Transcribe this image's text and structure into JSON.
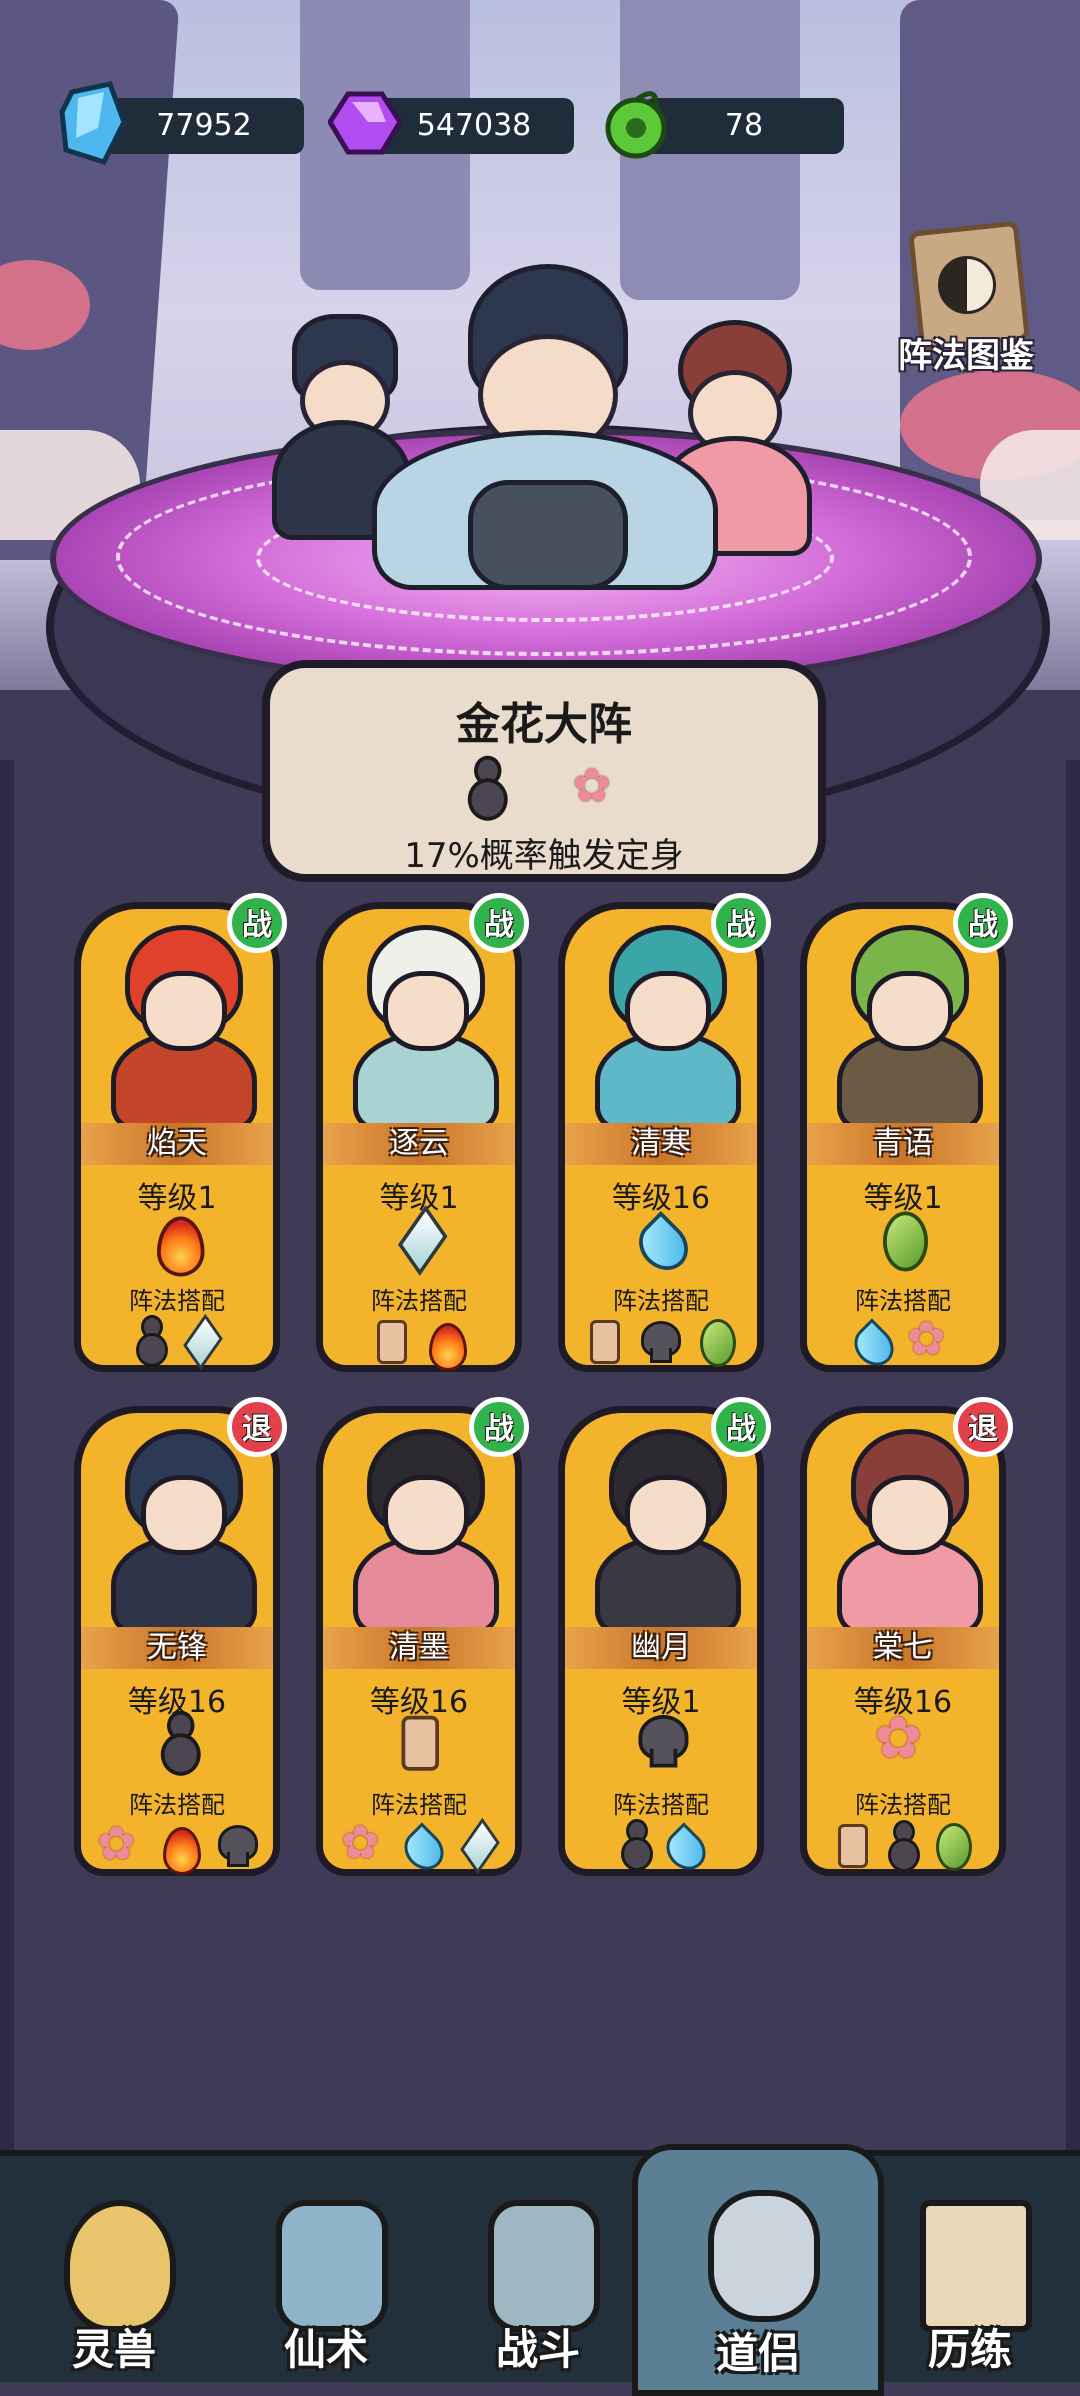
{
  "resources": [
    {
      "icon": "blue-crystal-icon",
      "value": "77952"
    },
    {
      "icon": "purple-gem-icon",
      "value": "547038"
    },
    {
      "icon": "green-jade-icon",
      "value": "78"
    }
  ],
  "codex": {
    "label": "阵法图鉴",
    "icon": "taiji-book-icon"
  },
  "formation": {
    "name": "金花大阵",
    "elements": [
      "gourd-icon",
      "flower-icon"
    ],
    "description": "17%概率触发定身"
  },
  "colors": {
    "fight_badge": "#2fb34a",
    "retire_badge": "#e2404a",
    "card_bg": "#f3b42c",
    "nav_bg": "#22303c",
    "nav_active": "#5b7f95"
  },
  "combo_label": "阵法搭配",
  "cards": [
    {
      "name": "焰天",
      "level": "等级1",
      "badge": "战",
      "status": "fight",
      "element": "fire",
      "combo": [
        "gourd",
        "metal"
      ],
      "hair": "#e0412a",
      "robe": "#c3452a"
    },
    {
      "name": "逐云",
      "level": "等级1",
      "badge": "战",
      "status": "fight",
      "element": "metal",
      "combo": [
        "talisman",
        "fire"
      ],
      "hair": "#eef0ea",
      "robe": "#a9d3d3"
    },
    {
      "name": "清寒",
      "level": "等级16",
      "badge": "战",
      "status": "fight",
      "element": "water",
      "combo": [
        "talisman",
        "skull",
        "wood"
      ],
      "hair": "#3aa6a8",
      "robe": "#5fb8c8"
    },
    {
      "name": "青语",
      "level": "等级1",
      "badge": "战",
      "status": "fight",
      "element": "wood",
      "combo": [
        "water",
        "flower"
      ],
      "hair": "#79b548",
      "robe": "#6b5a44"
    },
    {
      "name": "无锋",
      "level": "等级16",
      "badge": "退",
      "status": "retire",
      "element": "gourd",
      "combo": [
        "flower",
        "fire",
        "skull"
      ],
      "hair": "#2d3a55",
      "robe": "#2f3548"
    },
    {
      "name": "清墨",
      "level": "等级16",
      "badge": "战",
      "status": "fight",
      "element": "talisman",
      "combo": [
        "flower",
        "water",
        "metal"
      ],
      "hair": "#2c2a30",
      "robe": "#e48a98"
    },
    {
      "name": "幽月",
      "level": "等级1",
      "badge": "战",
      "status": "fight",
      "element": "skull",
      "combo": [
        "gourd",
        "water"
      ],
      "hair": "#2c2a30",
      "robe": "#3a3840"
    },
    {
      "name": "棠七",
      "level": "等级16",
      "badge": "退",
      "status": "retire",
      "element": "flower",
      "combo": [
        "talisman",
        "gourd",
        "wood"
      ],
      "hair": "#8a3e3a",
      "robe": "#ef9aa4"
    }
  ],
  "nav": [
    {
      "label": "灵兽",
      "icon": "spirit-egg-icon",
      "color": "#e8c46a"
    },
    {
      "label": "仙术",
      "icon": "lightning-scroll-icon",
      "color": "#8fb3c8"
    },
    {
      "label": "战斗",
      "icon": "sword-icon",
      "color": "#9fb6c3"
    },
    {
      "label": "道侣",
      "icon": "companion-icon",
      "color": "#c9d4dc",
      "active": true
    },
    {
      "label": "历练",
      "icon": "painting-scroll-icon",
      "color": "#e8d8b8"
    }
  ]
}
